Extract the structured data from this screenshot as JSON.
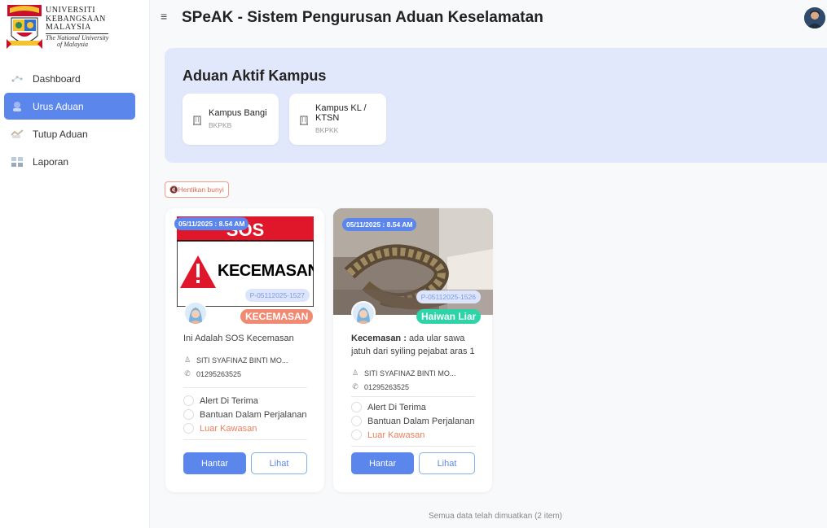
{
  "sidebar": {
    "logo": {
      "line1": "UNIVERSITI",
      "line2": "KEBANGSAAN",
      "line3": "MALAYSIA",
      "tagline_1": "The National University",
      "tagline_2": "of Malaysia"
    },
    "items": [
      {
        "label": "Dashboard",
        "icon": "dashboard-icon",
        "active": false
      },
      {
        "label": "Urus Aduan",
        "icon": "manage-icon",
        "active": true
      },
      {
        "label": "Tutup Aduan",
        "icon": "close-case-icon",
        "active": false
      },
      {
        "label": "Laporan",
        "icon": "report-icon",
        "active": false
      }
    ]
  },
  "header": {
    "menu_glyph": "≡",
    "title": "SPeAK - Sistem Pengurusan Aduan Keselamatan"
  },
  "banner": {
    "title": "Aduan Aktif Kampus",
    "campuses": [
      {
        "name": "Kampus Bangi",
        "name_line2": "",
        "code": "BKPKB"
      },
      {
        "name": "Kampus KL /",
        "name_line2": "KTSN",
        "code": "BKPKK"
      }
    ]
  },
  "stop_sound_label": "🔇Hentikan bunyi",
  "cards": [
    {
      "time": "05/11/2025 : 8.54 AM",
      "ref": "P-05112025-1527",
      "image": {
        "banner_text": "SOS",
        "alert_text": "KECEMASAN"
      },
      "category": "KECEMASAN",
      "category_color": "#f08a72",
      "desc_prefix": "",
      "desc": "Ini Adalah SOS Kecemasan",
      "reporter": "SITI SYAFINAZ BINTI MO...",
      "phone": "01295263525",
      "statuses": [
        "Alert Di Terima",
        "Bantuan Dalam Perjalanan",
        "Luar Kawasan"
      ],
      "send_label": "Hantar",
      "view_label": "Lihat"
    },
    {
      "time": "05/11/2025 : 8.54 AM",
      "ref": "P-05112025-1526",
      "image": {
        "banner_text": "",
        "alert_text": ""
      },
      "category": "Haiwan Liar",
      "category_color": "#2dd4a8",
      "desc_prefix": "Kecemasan : ",
      "desc": "ada ular sawa jatuh dari syiling pejabat aras 1",
      "reporter": "SITI SYAFINAZ BINTI MO...",
      "phone": "01295263525",
      "statuses": [
        "Alert Di Terima",
        "Bantuan Dalam Perjalanan",
        "Luar Kawasan"
      ],
      "send_label": "Hantar",
      "view_label": "Lihat"
    }
  ],
  "footer": "Semua data telah dimuatkan (2 item)",
  "colors": {
    "accent": "#5b86ec",
    "banner_bg": "#e2e8fb",
    "sos_red": "#e0162b",
    "warning_orange": "#e9805e"
  }
}
